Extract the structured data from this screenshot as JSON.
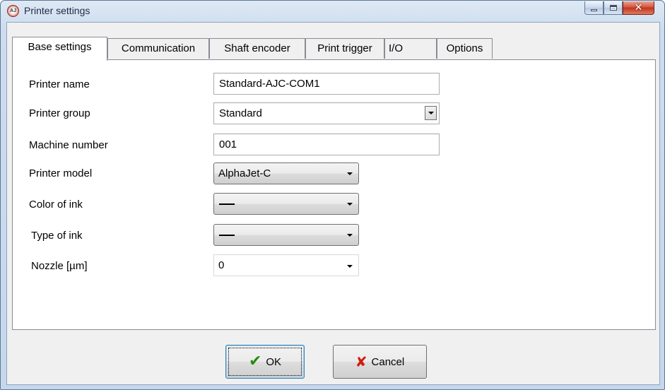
{
  "window": {
    "title": "Printer settings",
    "app_icon_text": "AJ"
  },
  "tabs": [
    {
      "label": "Base settings",
      "active": true
    },
    {
      "label": "Communication",
      "active": false
    },
    {
      "label": "Shaft encoder",
      "active": false
    },
    {
      "label": "Print trigger",
      "active": false
    },
    {
      "label": "I/O",
      "active": false
    },
    {
      "label": "Options",
      "active": false
    }
  ],
  "form": {
    "printer_name": {
      "label": "Printer name",
      "value": "Standard-AJC-COM1"
    },
    "printer_group": {
      "label": "Printer group",
      "value": "Standard"
    },
    "machine_number": {
      "label": "Machine number",
      "value": "001"
    },
    "printer_model": {
      "label": "Printer model",
      "value": "AlphaJet-C"
    },
    "color_of_ink": {
      "label": "Color of ink",
      "value": ""
    },
    "type_of_ink": {
      "label": "Type of ink",
      "value": ""
    },
    "nozzle": {
      "label": "Nozzle [µm]",
      "value": "0"
    }
  },
  "buttons": {
    "ok_label": "OK",
    "cancel_label": "Cancel"
  },
  "icons": {
    "minimize": "minimize-icon",
    "maximize": "maximize-icon",
    "close": "close-icon",
    "ok": "checkmark-icon",
    "cancel": "x-icon"
  },
  "colors": {
    "ok_check": "#2a8a12",
    "cancel_x": "#d21a0c",
    "close_button": "#c2351d"
  }
}
